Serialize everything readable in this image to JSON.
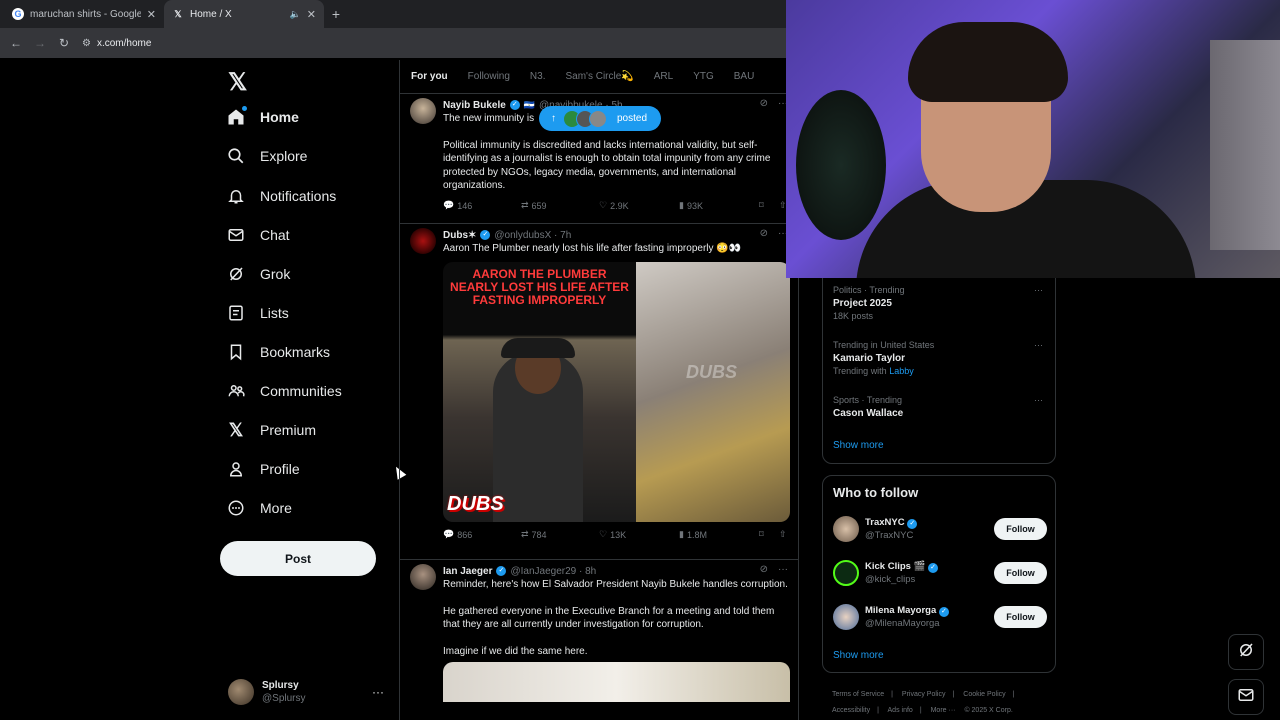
{
  "browser": {
    "tabs": [
      {
        "title": "maruchan shirts - Google Sear",
        "icon": "google-icon"
      },
      {
        "title": "Home / X",
        "icon": "x-icon"
      }
    ],
    "url": "x.com/home"
  },
  "nav": {
    "items": [
      {
        "label": "Home",
        "icon": "home-icon"
      },
      {
        "label": "Explore",
        "icon": "search-icon"
      },
      {
        "label": "Notifications",
        "icon": "bell-icon"
      },
      {
        "label": "Chat",
        "icon": "mail-icon"
      },
      {
        "label": "Grok",
        "icon": "grok-icon"
      },
      {
        "label": "Lists",
        "icon": "list-icon"
      },
      {
        "label": "Bookmarks",
        "icon": "bookmark-icon"
      },
      {
        "label": "Communities",
        "icon": "people-icon"
      },
      {
        "label": "Premium",
        "icon": "x-icon"
      },
      {
        "label": "Profile",
        "icon": "user-icon"
      },
      {
        "label": "More",
        "icon": "more-circle-icon"
      }
    ],
    "post_label": "Post",
    "account": {
      "name": "Splursy",
      "handle": "@Splursy"
    }
  },
  "feed": {
    "tabs": [
      "For you",
      "Following",
      "N3.",
      "Sam's Circle💫",
      "ARL",
      "YTG",
      "BAU"
    ],
    "new_posts_pill": "posted",
    "tweets": [
      {
        "name": "Nayib Bukele",
        "handle": "@nayibbukele · 5h",
        "line1": "The new immunity is",
        "paragraphs": [
          "Political immunity is discredited and lacks international validity, but self-identifying as a journalist is enough to obtain total impunity from any crime protected by NGOs, legacy media, governments, and international organizations."
        ],
        "replies": "146",
        "reposts": "659",
        "likes": "2.9K",
        "views": "93K"
      },
      {
        "name": "Dubs✶",
        "handle": "@onlydubsX · 7h",
        "line1": "Aaron The Plumber nearly lost his life after fasting improperly 😳👀",
        "media_caption": "AARON THE PLUMBER NEARLY LOST HIS LIFE AFTER FASTING IMPROPERLY",
        "media_brand": "DUBS",
        "replies": "866",
        "reposts": "784",
        "likes": "13K",
        "views": "1.8M"
      },
      {
        "name": "Ian Jaeger",
        "handle": "@IanJaeger29 · 8h",
        "line1": "Reminder, here's how El Salvador President Nayib Bukele handles corruption.",
        "paragraphs": [
          "He gathered everyone in the Executive Branch for a meeting and told them that they are all currently under investigation for corruption.",
          "Imagine if we did the same here."
        ]
      }
    ]
  },
  "trends": [
    {
      "context": "Politics · Trending",
      "title": "Project 2025",
      "meta": "18K posts",
      "link": ""
    },
    {
      "context": "Trending in United States",
      "title": "Kamario Taylor",
      "meta": "Trending with",
      "link": "Labby"
    },
    {
      "context": "Sports · Trending",
      "title": "Cason Wallace",
      "meta": "",
      "link": ""
    }
  ],
  "show_more": "Show more",
  "who_to_follow": {
    "title": "Who to follow",
    "accounts": [
      {
        "name": "TraxNYC",
        "handle": "@TraxNYC"
      },
      {
        "name": "Kick Clips 🎬",
        "handle": "@kick_clips"
      },
      {
        "name": "Milena Mayorga",
        "handle": "@MilenaMayorga"
      }
    ],
    "follow_label": "Follow"
  },
  "footer": [
    "Terms of Service",
    "|",
    "Privacy Policy",
    "|",
    "Cookie Policy",
    "|",
    "Accessibility",
    "|",
    "Ads info",
    "|",
    "More ···",
    "© 2025 X Corp."
  ],
  "colors": {
    "accent": "#1d9bf0",
    "background": "#000000",
    "text": "#e7e9ea",
    "muted": "#71767b"
  }
}
